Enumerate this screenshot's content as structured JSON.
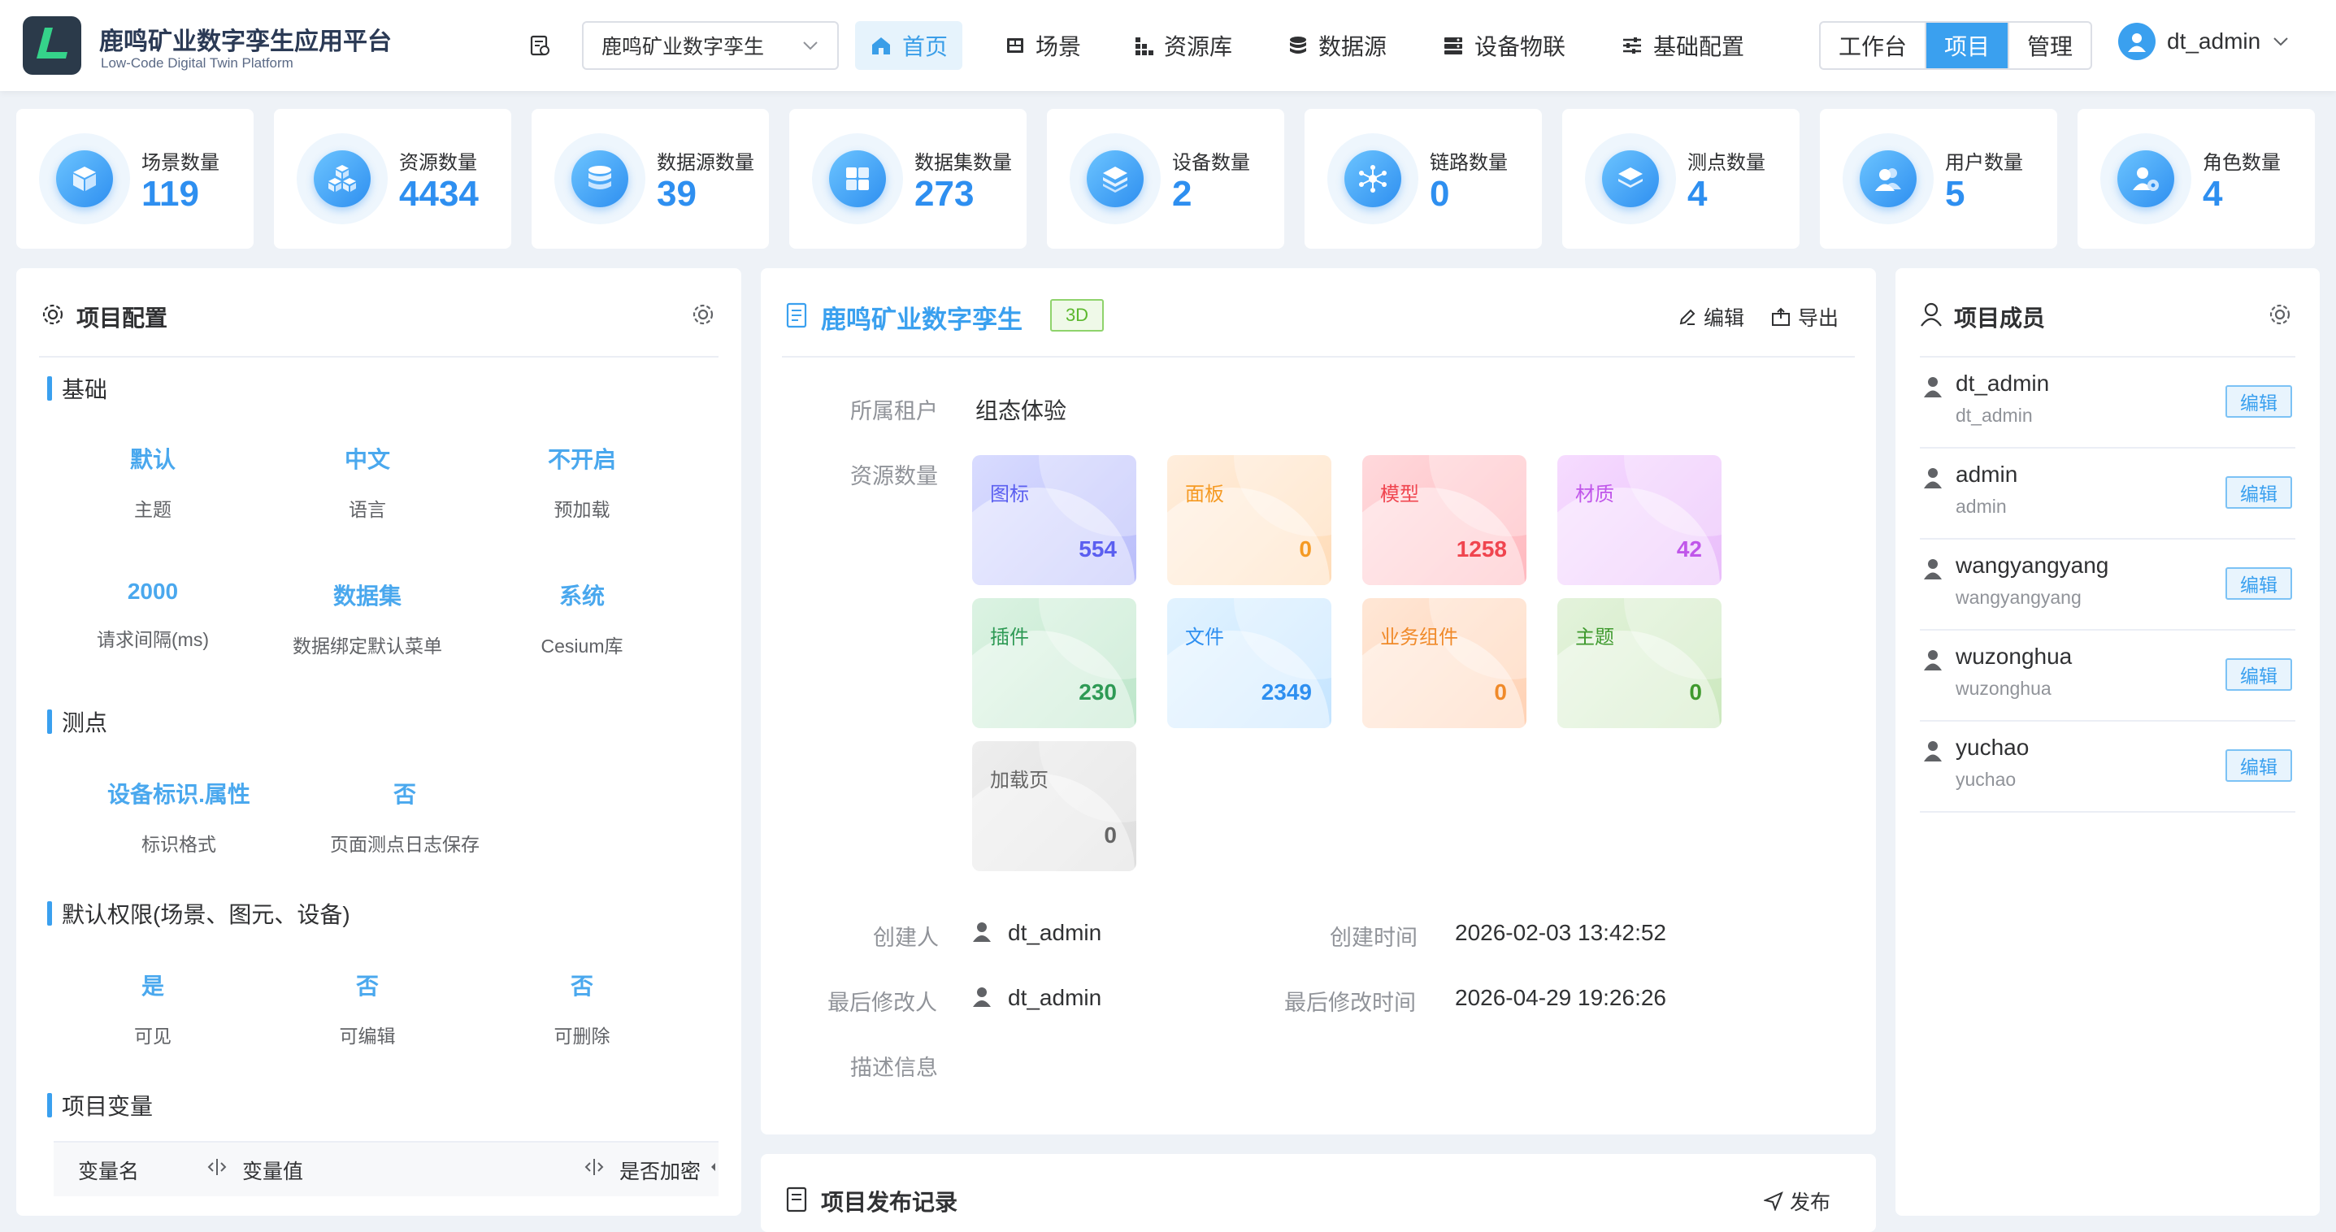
{
  "app": {
    "title": "鹿鸣矿业数字孪生应用平台",
    "subtitle": "Low-Code Digital Twin Platform"
  },
  "header": {
    "project_select": "鹿鸣矿业数字孪生",
    "nav": [
      {
        "label": "首页",
        "icon": "home-icon",
        "active": true
      },
      {
        "label": "场景",
        "icon": "scene-icon",
        "active": false
      },
      {
        "label": "资源库",
        "icon": "resource-icon",
        "active": false
      },
      {
        "label": "数据源",
        "icon": "database-icon",
        "active": false
      },
      {
        "label": "设备物联",
        "icon": "device-icon",
        "active": false
      },
      {
        "label": "基础配置",
        "icon": "sliders-icon",
        "active": false
      }
    ],
    "modes": [
      "工作台",
      "项目",
      "管理"
    ],
    "active_mode": "项目",
    "user": "dt_admin"
  },
  "stats": [
    {
      "label": "场景数量",
      "value": "119",
      "icon": "cube-icon"
    },
    {
      "label": "资源数量",
      "value": "4434",
      "icon": "cubes-icon"
    },
    {
      "label": "数据源数量",
      "value": "39",
      "icon": "database-icon"
    },
    {
      "label": "数据集数量",
      "value": "273",
      "icon": "grid-icon"
    },
    {
      "label": "设备数量",
      "value": "2",
      "icon": "layers-icon"
    },
    {
      "label": "链路数量",
      "value": "0",
      "icon": "network-icon"
    },
    {
      "label": "测点数量",
      "value": "4",
      "icon": "stack-icon"
    },
    {
      "label": "用户数量",
      "value": "5",
      "icon": "users-icon"
    },
    {
      "label": "角色数量",
      "value": "4",
      "icon": "user-gear-icon"
    }
  ],
  "config": {
    "title": "项目配置",
    "basic": {
      "title": "基础",
      "items": [
        {
          "value": "默认",
          "key": "主题"
        },
        {
          "value": "中文",
          "key": "语言"
        },
        {
          "value": "不开启",
          "key": "预加载"
        },
        {
          "value": "2000",
          "key": "请求间隔(ms)"
        },
        {
          "value": "数据集",
          "key": "数据绑定默认菜单"
        },
        {
          "value": "系统",
          "key": "Cesium库"
        }
      ]
    },
    "points": {
      "title": "测点",
      "items": [
        {
          "value": "设备标识.属性",
          "key": "标识格式"
        },
        {
          "value": "否",
          "key": "页面测点日志保存"
        }
      ]
    },
    "perm": {
      "title": "默认权限(场景、图元、设备)",
      "items": [
        {
          "value": "是",
          "key": "可见"
        },
        {
          "value": "否",
          "key": "可编辑"
        },
        {
          "value": "否",
          "key": "可删除"
        }
      ]
    },
    "vars": {
      "title": "项目变量",
      "columns": [
        "变量名",
        "变量值",
        "是否加密"
      ]
    }
  },
  "project": {
    "name": "鹿鸣矿业数字孪生",
    "tag": "3D",
    "edit_label": "编辑",
    "export_label": "导出",
    "tenant_label": "所属租户",
    "tenant": "组态体验",
    "resource_label": "资源数量",
    "resources": [
      {
        "name": "图标",
        "count": "554",
        "color": "#5b5ff0",
        "bg": "linear-gradient(135deg,#d9dcff,#b9bdfa)"
      },
      {
        "name": "面板",
        "count": "0",
        "color": "#f59a23",
        "bg": "linear-gradient(135deg,#ffeedd,#ffdcb8)"
      },
      {
        "name": "模型",
        "count": "1258",
        "color": "#f0454f",
        "bg": "linear-gradient(135deg,#ffd9dc,#ffb9bf)"
      },
      {
        "name": "材质",
        "count": "42",
        "color": "#c056ea",
        "bg": "linear-gradient(135deg,#f6dcff,#e9bdfa)"
      },
      {
        "name": "插件",
        "count": "230",
        "color": "#2e9a55",
        "bg": "linear-gradient(135deg,#dcf3e3,#bde6ca)"
      },
      {
        "name": "文件",
        "count": "2349",
        "color": "#2e8ff0",
        "bg": "linear-gradient(135deg,#e2f3ff,#c4e4ff)"
      },
      {
        "name": "业务组件",
        "count": "0",
        "color": "#f08a2a",
        "bg": "linear-gradient(135deg,#ffe7d6,#ffd2b5)"
      },
      {
        "name": "主题",
        "count": "0",
        "color": "#3f9a2e",
        "bg": "linear-gradient(135deg,#e4f3dc,#cce8be)"
      },
      {
        "name": "加载页",
        "count": "0",
        "color": "#666666",
        "bg": "linear-gradient(135deg,#eeeeee,#dedede)"
      }
    ],
    "creator_label": "创建人",
    "creator": "dt_admin",
    "created_label": "创建时间",
    "created": "2026-02-03 13:42:52",
    "modifier_label": "最后修改人",
    "modifier": "dt_admin",
    "modified_label": "最后修改时间",
    "modified": "2026-04-29 19:26:26",
    "desc_label": "描述信息"
  },
  "publish": {
    "title": "项目发布记录",
    "button": "发布"
  },
  "members": {
    "title": "项目成员",
    "edit_label": "编辑",
    "list": [
      {
        "name": "dt_admin",
        "account": "dt_admin"
      },
      {
        "name": "admin",
        "account": "admin"
      },
      {
        "name": "wangyangyang",
        "account": "wangyangyang"
      },
      {
        "name": "wuzonghua",
        "account": "wuzonghua"
      },
      {
        "name": "yuchao",
        "account": "yuchao"
      }
    ]
  },
  "colors": {
    "accent": "#3aa0ef",
    "brand_dark": "#2b3a4a"
  }
}
